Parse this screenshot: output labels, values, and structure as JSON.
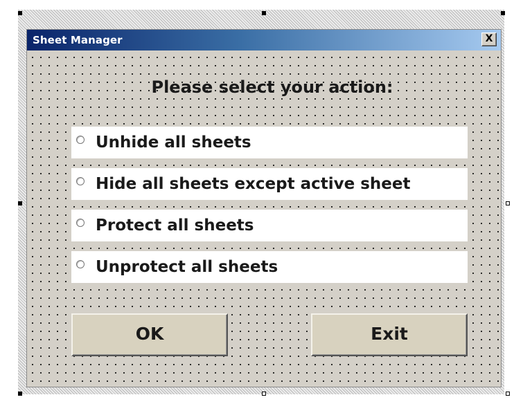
{
  "window": {
    "title": "Sheet Manager",
    "close_label": "X"
  },
  "prompt": "Please select your action:",
  "options": [
    {
      "label": "Unhide all sheets",
      "selected": false
    },
    {
      "label": "Hide all sheets except active sheet",
      "selected": false
    },
    {
      "label": "Protect all sheets",
      "selected": false
    },
    {
      "label": "Unprotect all sheets",
      "selected": false
    }
  ],
  "buttons": {
    "ok_label": "OK",
    "exit_label": "Exit"
  },
  "colors": {
    "form_background": "#d4d0c8",
    "title_gradient_start": "#0a246a",
    "title_gradient_end": "#a6caf0",
    "option_background": "#ffffff",
    "button_background": "#d8d2bf"
  },
  "icons": {
    "close": "close-icon",
    "radio": "radio-button-icon"
  }
}
